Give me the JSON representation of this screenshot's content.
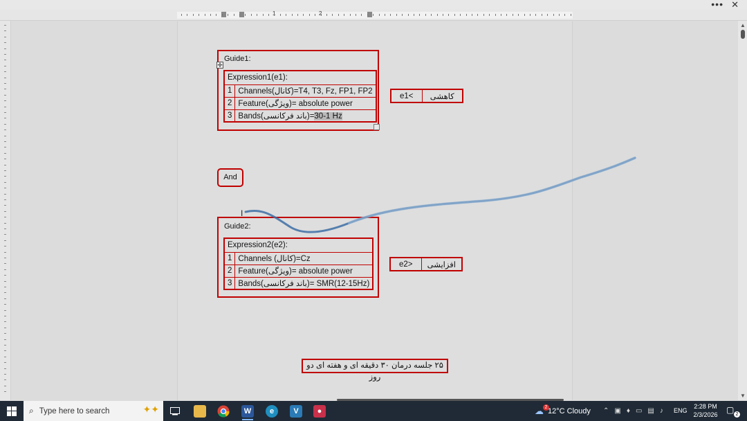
{
  "window": {
    "more_label": "•••",
    "close_label": "✕"
  },
  "ruler": {
    "numbers": [
      "1",
      "2"
    ]
  },
  "document": {
    "guide1": {
      "label": "Guide1:",
      "expression_header": "Expression1(e1):",
      "rows": [
        {
          "num": "1",
          "text": "Channels(کانال)=T4, T3, Fz, FP1, FP2"
        },
        {
          "num": "2",
          "text": "Feature(ویژگی)= absolute power"
        },
        {
          "num": "3",
          "text_prefix": "Bands(باند فرکانسی)=",
          "text_highlight": "1-30 Hz"
        }
      ],
      "side": {
        "left": "e1<",
        "right": "کاهشی"
      }
    },
    "connector": "And",
    "guide2": {
      "label": "Guide2:",
      "expression_header": "Expression2(e2):",
      "rows": [
        {
          "num": "1",
          "text": "Channels (کانال)=Cz"
        },
        {
          "num": "2",
          "text": "Feature(ویژگی)= absolute power"
        },
        {
          "num": "3",
          "text": "Bands(باند فرکانسی)= SMR(12-15Hz)"
        }
      ],
      "side": {
        "left": "e2>",
        "right": "افزایشی"
      }
    },
    "note": "۲۵ جلسه درمان ۳۰ دقیقه ای و هفته ای دو روز"
  },
  "taskbar": {
    "search_placeholder": "Type here to search",
    "apps": [
      "task-view",
      "file-explorer",
      "chrome",
      "word",
      "edge",
      "app-v",
      "app-red"
    ],
    "weather": {
      "badge": "2",
      "text": "12°C  Cloudy"
    },
    "language": "ENG",
    "time": "2:28 PM",
    "date": "2/3/2026",
    "notification_count": "2"
  },
  "colors": {
    "table_border": "#c00000",
    "taskbar_bg": "#1f2a36",
    "ink_stroke": "#3d6fa6"
  }
}
